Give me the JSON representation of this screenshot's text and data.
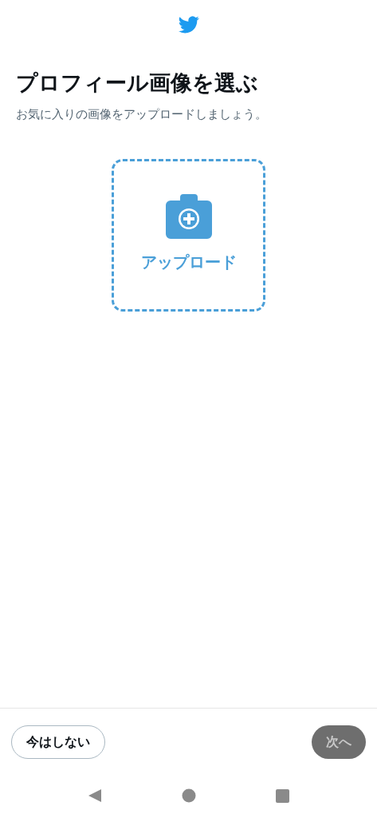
{
  "title": "プロフィール画像を選ぶ",
  "subtitle": "お気に入りの画像をアップロードしましょう。",
  "upload": {
    "label": "アップロード"
  },
  "buttons": [
    {
      "kind": "outline",
      "label": "今はしない",
      "disabled": false
    },
    {
      "kind": "filled",
      "label": "次へ",
      "disabled": true
    }
  ]
}
